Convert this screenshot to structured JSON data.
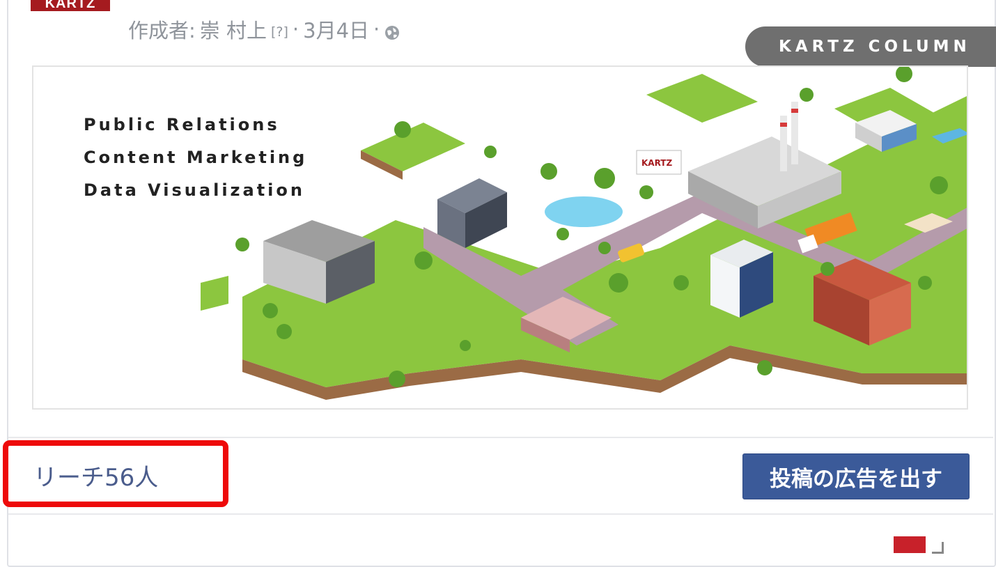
{
  "post": {
    "brand_logo_text": "KARTZ",
    "author_prefix": "作成者:",
    "author_name": "崇 村上",
    "help_marker": "[?]",
    "separator": "·",
    "date": "3月4日",
    "privacy_icon": "globe-icon"
  },
  "badge": {
    "label": "KARTZ COLUMN",
    "color": "#6f6f6f"
  },
  "hero": {
    "taglines": [
      "Public Relations",
      "Content Marketing",
      "Data Visualization"
    ],
    "sign_text": "KARTZ"
  },
  "footer": {
    "reach_label": "リーチ56人",
    "boost_button_label": "投稿の広告を出す",
    "boost_button_color": "#3b5a99",
    "highlight_color": "#ee0a0a"
  }
}
